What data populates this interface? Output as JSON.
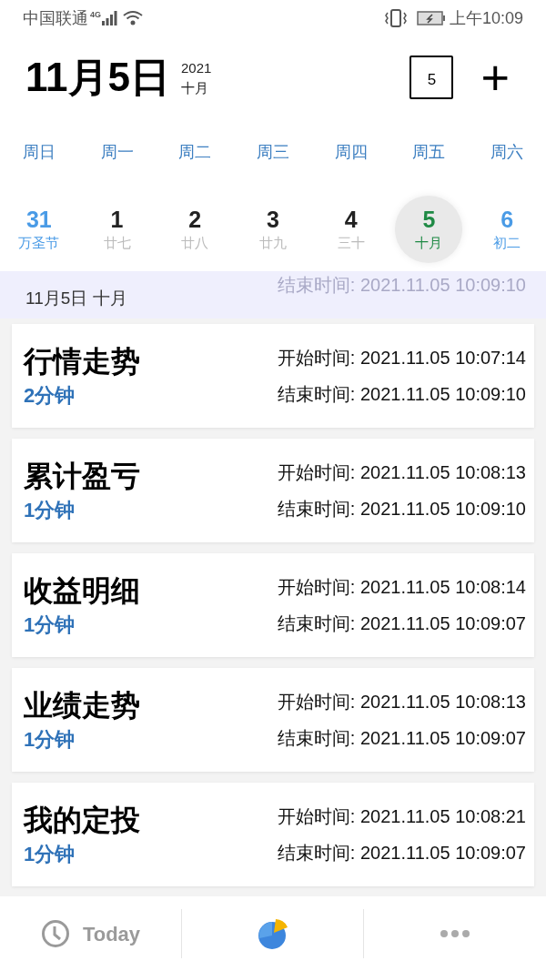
{
  "status_bar": {
    "carrier": "中国联通",
    "network": "4G",
    "time": "上午10:09"
  },
  "header": {
    "date": "11月5日",
    "year": "2021",
    "lunar_month": "十月",
    "calendar_day": "5",
    "add": "+"
  },
  "weekdays": [
    "周日",
    "周一",
    "周二",
    "周三",
    "周四",
    "周五",
    "周六"
  ],
  "days": [
    {
      "day": "31",
      "lunar": "万圣节",
      "kind": "weekend",
      "selected": false
    },
    {
      "day": "1",
      "lunar": "廿七",
      "kind": "weekday",
      "selected": false
    },
    {
      "day": "2",
      "lunar": "廿八",
      "kind": "weekday",
      "selected": false
    },
    {
      "day": "3",
      "lunar": "廿九",
      "kind": "weekday",
      "selected": false
    },
    {
      "day": "4",
      "lunar": "三十",
      "kind": "weekday",
      "selected": false
    },
    {
      "day": "5",
      "lunar": "十月",
      "kind": "weekday",
      "selected": true
    },
    {
      "day": "6",
      "lunar": "初二",
      "kind": "weekend",
      "selected": false
    }
  ],
  "scrolled_peek": {
    "end": "结束时间: 2021.11.05 10:09:10"
  },
  "section_header": "11月5日 十月",
  "entries": [
    {
      "title": "行情走势",
      "duration": "2分钟",
      "start": "开始时间: 2021.11.05 10:07:14",
      "end": "结束时间: 2021.11.05 10:09:10"
    },
    {
      "title": "累计盈亏",
      "duration": "1分钟",
      "start": "开始时间: 2021.11.05 10:08:13",
      "end": "结束时间: 2021.11.05 10:09:10"
    },
    {
      "title": "收益明细",
      "duration": "1分钟",
      "start": "开始时间: 2021.11.05 10:08:14",
      "end": "结束时间: 2021.11.05 10:09:07"
    },
    {
      "title": "业绩走势",
      "duration": "1分钟",
      "start": "开始时间: 2021.11.05 10:08:13",
      "end": "结束时间: 2021.11.05 10:09:07"
    },
    {
      "title": "我的定投",
      "duration": "1分钟",
      "start": "开始时间: 2021.11.05 10:08:21",
      "end": "结束时间: 2021.11.05 10:09:07"
    }
  ],
  "bottom_nav": {
    "today": "Today"
  }
}
